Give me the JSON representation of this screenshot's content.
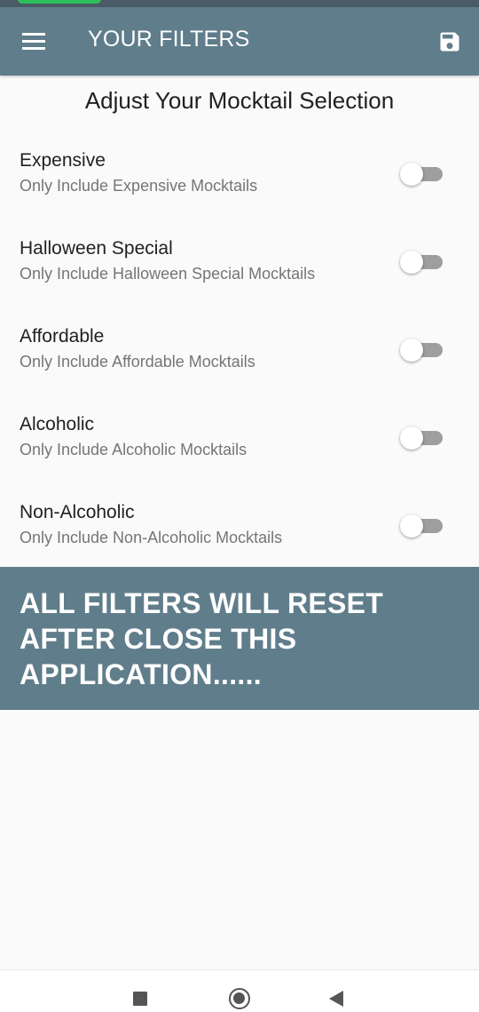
{
  "app_bar": {
    "title": "YOUR FILTERS",
    "menu_icon": "hamburger-menu-icon",
    "save_icon": "save-floppy-icon",
    "background": "#607d8b"
  },
  "heading": "Adjust Your Mocktail Selection",
  "filters": [
    {
      "title": "Expensive",
      "subtitle": "Only Include Expensive Mocktails",
      "enabled": false
    },
    {
      "title": "Halloween Special",
      "subtitle": "Only Include Halloween Special Mocktails",
      "enabled": false
    },
    {
      "title": "Affordable",
      "subtitle": "Only Include Affordable Mocktails",
      "enabled": false
    },
    {
      "title": "Alcoholic",
      "subtitle": "Only Include Alcoholic Mocktails",
      "enabled": false
    },
    {
      "title": "Non-Alcoholic",
      "subtitle": "Only Include Non-Alcoholic Mocktails",
      "enabled": false
    }
  ],
  "banner": {
    "line1": "ALL FILTERS WILL RESET",
    "line2": "AFTER CLOSE THIS",
    "line3": "APPLICATION......"
  },
  "nav_bar": {
    "recents_icon": "square-recents-icon",
    "home_icon": "circle-home-icon",
    "back_icon": "triangle-back-icon"
  }
}
